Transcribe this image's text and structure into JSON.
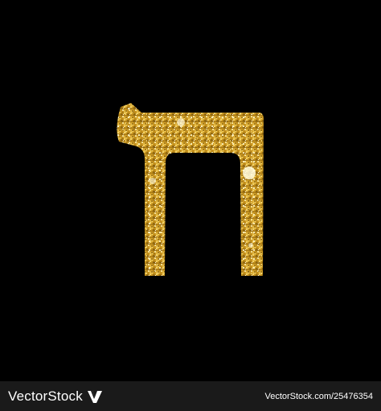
{
  "artwork": {
    "subject_icon": "hebrew-letter-chet-icon",
    "background_color": "#000000",
    "glitter_colors": [
      "#f5d76e",
      "#d4a12a",
      "#8a6410",
      "#fff3b0"
    ]
  },
  "footer": {
    "brand_text": "VectorStock",
    "brand_mark_icon": "vectorstock-logo-icon",
    "credit_text": "VectorStock.com/25476354",
    "background_color": "#1a1a1a"
  }
}
